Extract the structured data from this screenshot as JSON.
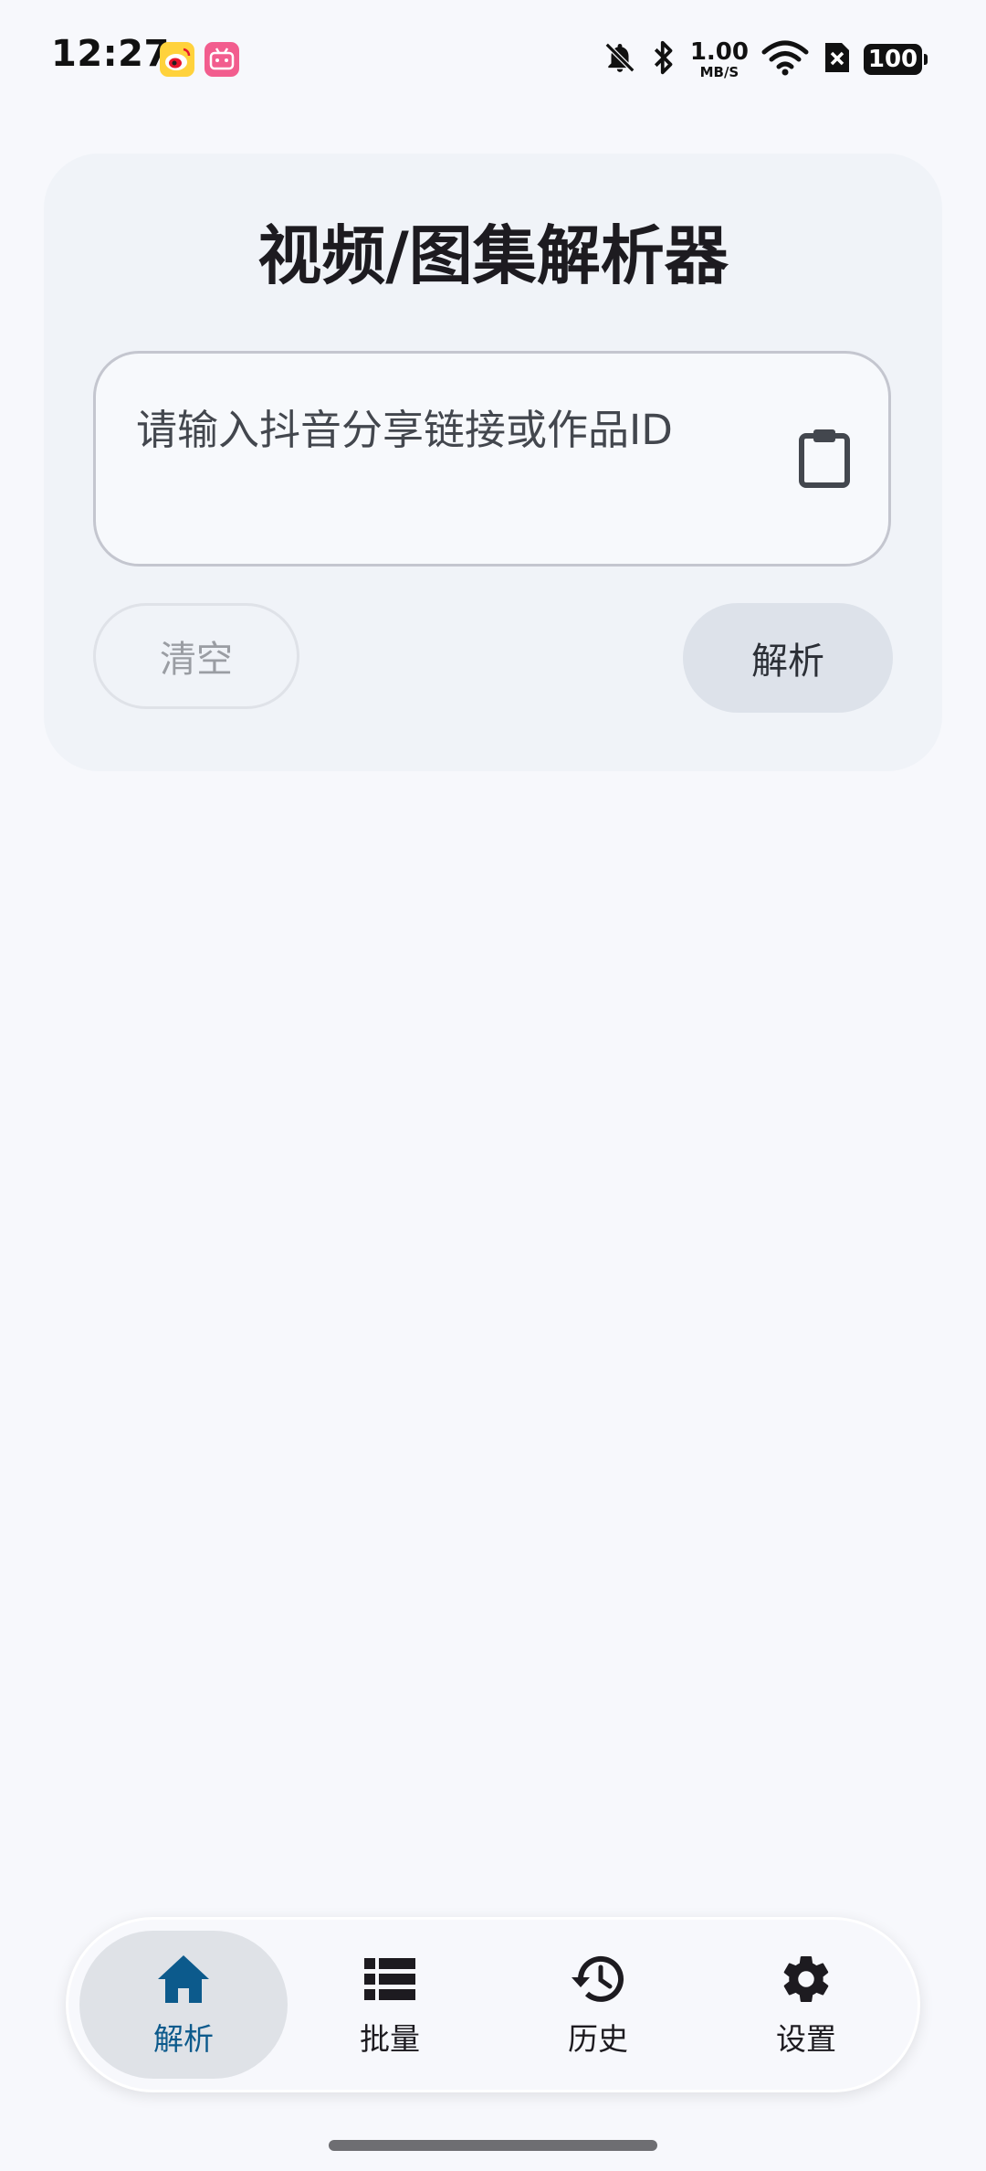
{
  "status_bar": {
    "time": "12:27",
    "net_speed_value": "1.00",
    "net_speed_unit": "MB/S",
    "battery_level": "100",
    "icons": [
      "weibo-app-icon",
      "bilibili-app-icon",
      "bell-off-icon",
      "bluetooth-icon",
      "wifi-icon",
      "sim-off-icon",
      "battery-icon"
    ]
  },
  "parser_card": {
    "title": "视频/图集解析器",
    "input_placeholder": "请输入抖音分享链接或作品ID",
    "paste_icon": "clipboard-icon",
    "clear_label": "清空",
    "parse_label": "解析"
  },
  "bottom_nav": {
    "items": [
      {
        "label": "解析",
        "icon": "home-icon",
        "active": true
      },
      {
        "label": "批量",
        "icon": "list-icon",
        "active": false
      },
      {
        "label": "历史",
        "icon": "history-icon",
        "active": false
      },
      {
        "label": "设置",
        "icon": "gear-icon",
        "active": false
      }
    ]
  },
  "colors": {
    "background": "#f7f8fc",
    "card": "#f0f3f8",
    "active_nav": "#0c5a8c",
    "parse_button": "#dde2ea"
  }
}
